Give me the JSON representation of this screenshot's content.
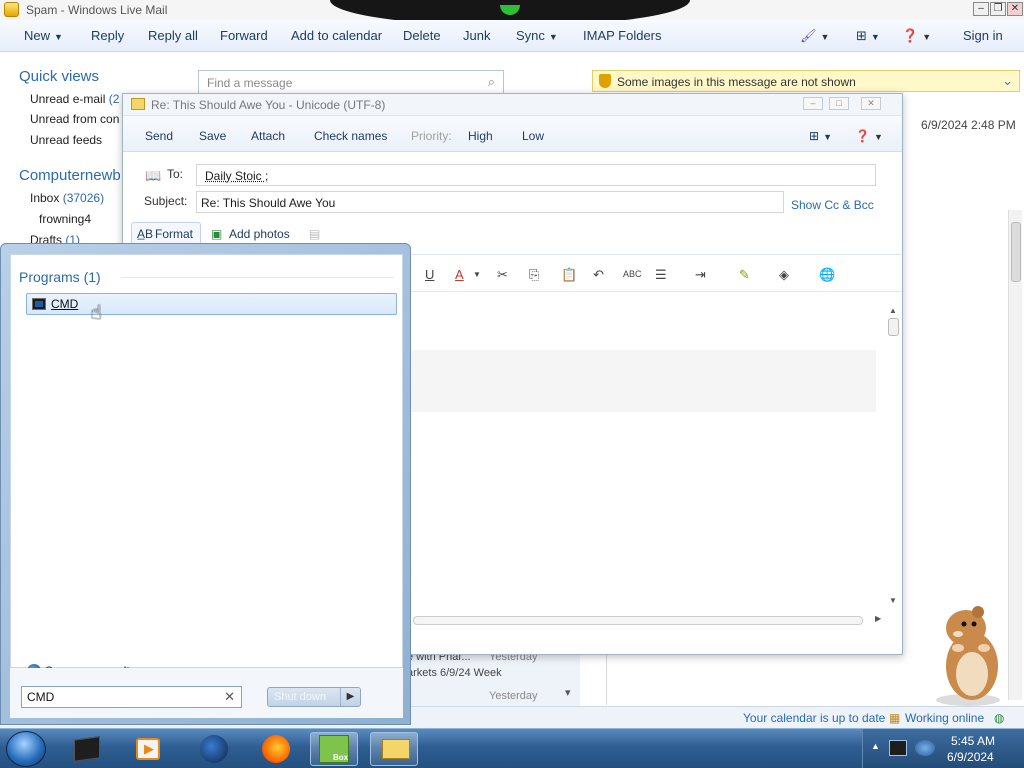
{
  "main_window": {
    "title": "Spam - Windows Live Mail",
    "commands": [
      "New",
      "Reply",
      "Reply all",
      "Forward",
      "Add to calendar",
      "Delete",
      "Junk",
      "Sync",
      "IMAP Folders"
    ],
    "sign_in": "Sign in"
  },
  "nav": {
    "quick_views_title": "Quick views",
    "quick_views": [
      "Unread e-mail",
      "Unread from con",
      "Unread feeds"
    ],
    "unread_count": "(2",
    "account_title": "Computernewb",
    "inbox_label": "Inbox",
    "inbox_count": "(37026)",
    "subfolder": "frowning4",
    "drafts_label": "Drafts",
    "drafts_count": "(1)"
  },
  "search": {
    "placeholder": "Find a message"
  },
  "reading_pane": {
    "banner": "Some images in this message are not shown",
    "date": "6/9/2024 2:48 PM"
  },
  "message_list_remnants": [
    "e with Phar...",
    "Yesterday",
    "arkets 6/9/24 Week",
    "Yesterday"
  ],
  "status_bar": {
    "calendar": "Your calendar is up to date",
    "online": "Working online"
  },
  "compose": {
    "title": "Re: This Should Awe You - Unicode (UTF-8)",
    "commands": [
      "Send",
      "Save",
      "Attach",
      "Check names"
    ],
    "priority_label": "Priority:",
    "priority_high": "High",
    "priority_low": "Low",
    "to_label": "To:",
    "to_value": "Daily Stoic ;",
    "subject_label": "Subject:",
    "subject_value": "Re: This Should Awe You",
    "show_cc_bcc": "Show Cc & Bcc",
    "tabs": [
      "Format",
      "Add photos"
    ],
    "format_tools": [
      "U",
      "A",
      "✂",
      "⎘",
      "📋",
      "↶",
      "ABC",
      "☰",
      "⇥",
      "✎",
      "◈",
      "🌐"
    ]
  },
  "start_menu": {
    "programs_header": "Programs (1)",
    "program_item": "CMD",
    "see_more": "See more results",
    "search_value": "CMD",
    "shutdown_label": "Shut down"
  },
  "taskbar": {
    "time": "5:45 AM",
    "date": "6/9/2024",
    "box_label": "Box"
  },
  "colors": {
    "accent": "#2a6aad",
    "taskbar": "#2f5e92",
    "highlight": "#d8e8fb"
  }
}
